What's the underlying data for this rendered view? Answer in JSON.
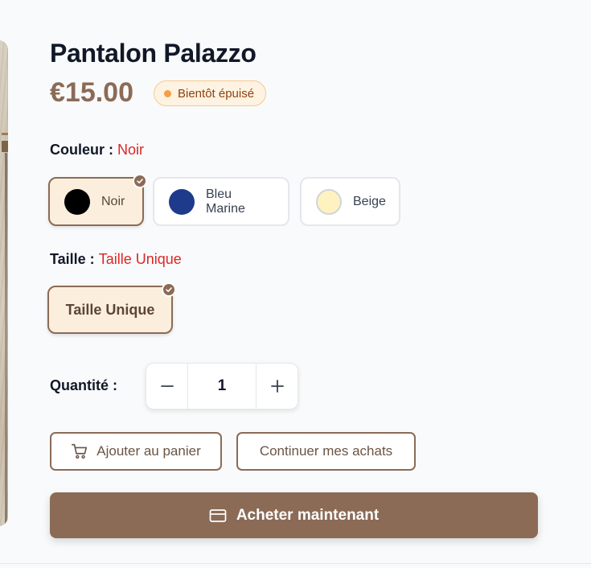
{
  "product": {
    "title": "Pantalon Palazzo",
    "price": "€15.00",
    "stock_badge": "Bientôt épuisé"
  },
  "colors": {
    "label": "Couleur :",
    "selected": "Noir",
    "options": [
      {
        "label": "Noir",
        "hex": "#000000",
        "selected": true
      },
      {
        "label": "Bleu Marine",
        "hex": "#1e3a8a",
        "selected": false
      },
      {
        "label": "Beige",
        "hex": "#fdf2c0",
        "selected": false
      }
    ]
  },
  "sizes": {
    "label": "Taille :",
    "selected": "Taille Unique",
    "options": [
      {
        "label": "Taille Unique",
        "selected": true
      }
    ]
  },
  "quantity": {
    "label": "Quantité :",
    "value": "1"
  },
  "actions": {
    "add_to_cart": "Ajouter au panier",
    "continue_shopping": "Continuer mes achats",
    "buy_now": "Acheter maintenant"
  },
  "icons": {
    "stock": "status-dot-icon",
    "selected": "check-icon",
    "decrease": "minus-icon",
    "increase": "plus-icon",
    "cart": "cart-icon",
    "buy": "credit-card-icon"
  },
  "theme": {
    "accent": "#8b6b56",
    "selected_bg": "#fbeedd",
    "highlight": "#dc2626",
    "badge_bg": "#fef3e2",
    "badge_dot": "#f59e42",
    "badge_text": "#92400e"
  }
}
